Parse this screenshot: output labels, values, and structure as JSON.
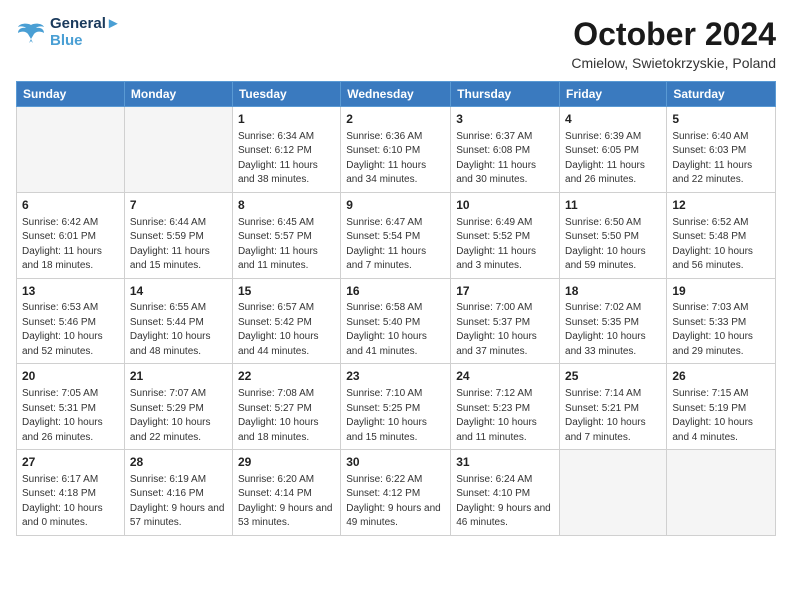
{
  "header": {
    "logo_line1": "General",
    "logo_line2": "Blue",
    "main_title": "October 2024",
    "subtitle": "Cmielow, Swietokrzyskie, Poland"
  },
  "days_of_week": [
    "Sunday",
    "Monday",
    "Tuesday",
    "Wednesday",
    "Thursday",
    "Friday",
    "Saturday"
  ],
  "weeks": [
    [
      {
        "day": "",
        "info": ""
      },
      {
        "day": "",
        "info": ""
      },
      {
        "day": "1",
        "info": "Sunrise: 6:34 AM\nSunset: 6:12 PM\nDaylight: 11 hours and 38 minutes."
      },
      {
        "day": "2",
        "info": "Sunrise: 6:36 AM\nSunset: 6:10 PM\nDaylight: 11 hours and 34 minutes."
      },
      {
        "day": "3",
        "info": "Sunrise: 6:37 AM\nSunset: 6:08 PM\nDaylight: 11 hours and 30 minutes."
      },
      {
        "day": "4",
        "info": "Sunrise: 6:39 AM\nSunset: 6:05 PM\nDaylight: 11 hours and 26 minutes."
      },
      {
        "day": "5",
        "info": "Sunrise: 6:40 AM\nSunset: 6:03 PM\nDaylight: 11 hours and 22 minutes."
      }
    ],
    [
      {
        "day": "6",
        "info": "Sunrise: 6:42 AM\nSunset: 6:01 PM\nDaylight: 11 hours and 18 minutes."
      },
      {
        "day": "7",
        "info": "Sunrise: 6:44 AM\nSunset: 5:59 PM\nDaylight: 11 hours and 15 minutes."
      },
      {
        "day": "8",
        "info": "Sunrise: 6:45 AM\nSunset: 5:57 PM\nDaylight: 11 hours and 11 minutes."
      },
      {
        "day": "9",
        "info": "Sunrise: 6:47 AM\nSunset: 5:54 PM\nDaylight: 11 hours and 7 minutes."
      },
      {
        "day": "10",
        "info": "Sunrise: 6:49 AM\nSunset: 5:52 PM\nDaylight: 11 hours and 3 minutes."
      },
      {
        "day": "11",
        "info": "Sunrise: 6:50 AM\nSunset: 5:50 PM\nDaylight: 10 hours and 59 minutes."
      },
      {
        "day": "12",
        "info": "Sunrise: 6:52 AM\nSunset: 5:48 PM\nDaylight: 10 hours and 56 minutes."
      }
    ],
    [
      {
        "day": "13",
        "info": "Sunrise: 6:53 AM\nSunset: 5:46 PM\nDaylight: 10 hours and 52 minutes."
      },
      {
        "day": "14",
        "info": "Sunrise: 6:55 AM\nSunset: 5:44 PM\nDaylight: 10 hours and 48 minutes."
      },
      {
        "day": "15",
        "info": "Sunrise: 6:57 AM\nSunset: 5:42 PM\nDaylight: 10 hours and 44 minutes."
      },
      {
        "day": "16",
        "info": "Sunrise: 6:58 AM\nSunset: 5:40 PM\nDaylight: 10 hours and 41 minutes."
      },
      {
        "day": "17",
        "info": "Sunrise: 7:00 AM\nSunset: 5:37 PM\nDaylight: 10 hours and 37 minutes."
      },
      {
        "day": "18",
        "info": "Sunrise: 7:02 AM\nSunset: 5:35 PM\nDaylight: 10 hours and 33 minutes."
      },
      {
        "day": "19",
        "info": "Sunrise: 7:03 AM\nSunset: 5:33 PM\nDaylight: 10 hours and 29 minutes."
      }
    ],
    [
      {
        "day": "20",
        "info": "Sunrise: 7:05 AM\nSunset: 5:31 PM\nDaylight: 10 hours and 26 minutes."
      },
      {
        "day": "21",
        "info": "Sunrise: 7:07 AM\nSunset: 5:29 PM\nDaylight: 10 hours and 22 minutes."
      },
      {
        "day": "22",
        "info": "Sunrise: 7:08 AM\nSunset: 5:27 PM\nDaylight: 10 hours and 18 minutes."
      },
      {
        "day": "23",
        "info": "Sunrise: 7:10 AM\nSunset: 5:25 PM\nDaylight: 10 hours and 15 minutes."
      },
      {
        "day": "24",
        "info": "Sunrise: 7:12 AM\nSunset: 5:23 PM\nDaylight: 10 hours and 11 minutes."
      },
      {
        "day": "25",
        "info": "Sunrise: 7:14 AM\nSunset: 5:21 PM\nDaylight: 10 hours and 7 minutes."
      },
      {
        "day": "26",
        "info": "Sunrise: 7:15 AM\nSunset: 5:19 PM\nDaylight: 10 hours and 4 minutes."
      }
    ],
    [
      {
        "day": "27",
        "info": "Sunrise: 6:17 AM\nSunset: 4:18 PM\nDaylight: 10 hours and 0 minutes."
      },
      {
        "day": "28",
        "info": "Sunrise: 6:19 AM\nSunset: 4:16 PM\nDaylight: 9 hours and 57 minutes."
      },
      {
        "day": "29",
        "info": "Sunrise: 6:20 AM\nSunset: 4:14 PM\nDaylight: 9 hours and 53 minutes."
      },
      {
        "day": "30",
        "info": "Sunrise: 6:22 AM\nSunset: 4:12 PM\nDaylight: 9 hours and 49 minutes."
      },
      {
        "day": "31",
        "info": "Sunrise: 6:24 AM\nSunset: 4:10 PM\nDaylight: 9 hours and 46 minutes."
      },
      {
        "day": "",
        "info": ""
      },
      {
        "day": "",
        "info": ""
      }
    ]
  ]
}
